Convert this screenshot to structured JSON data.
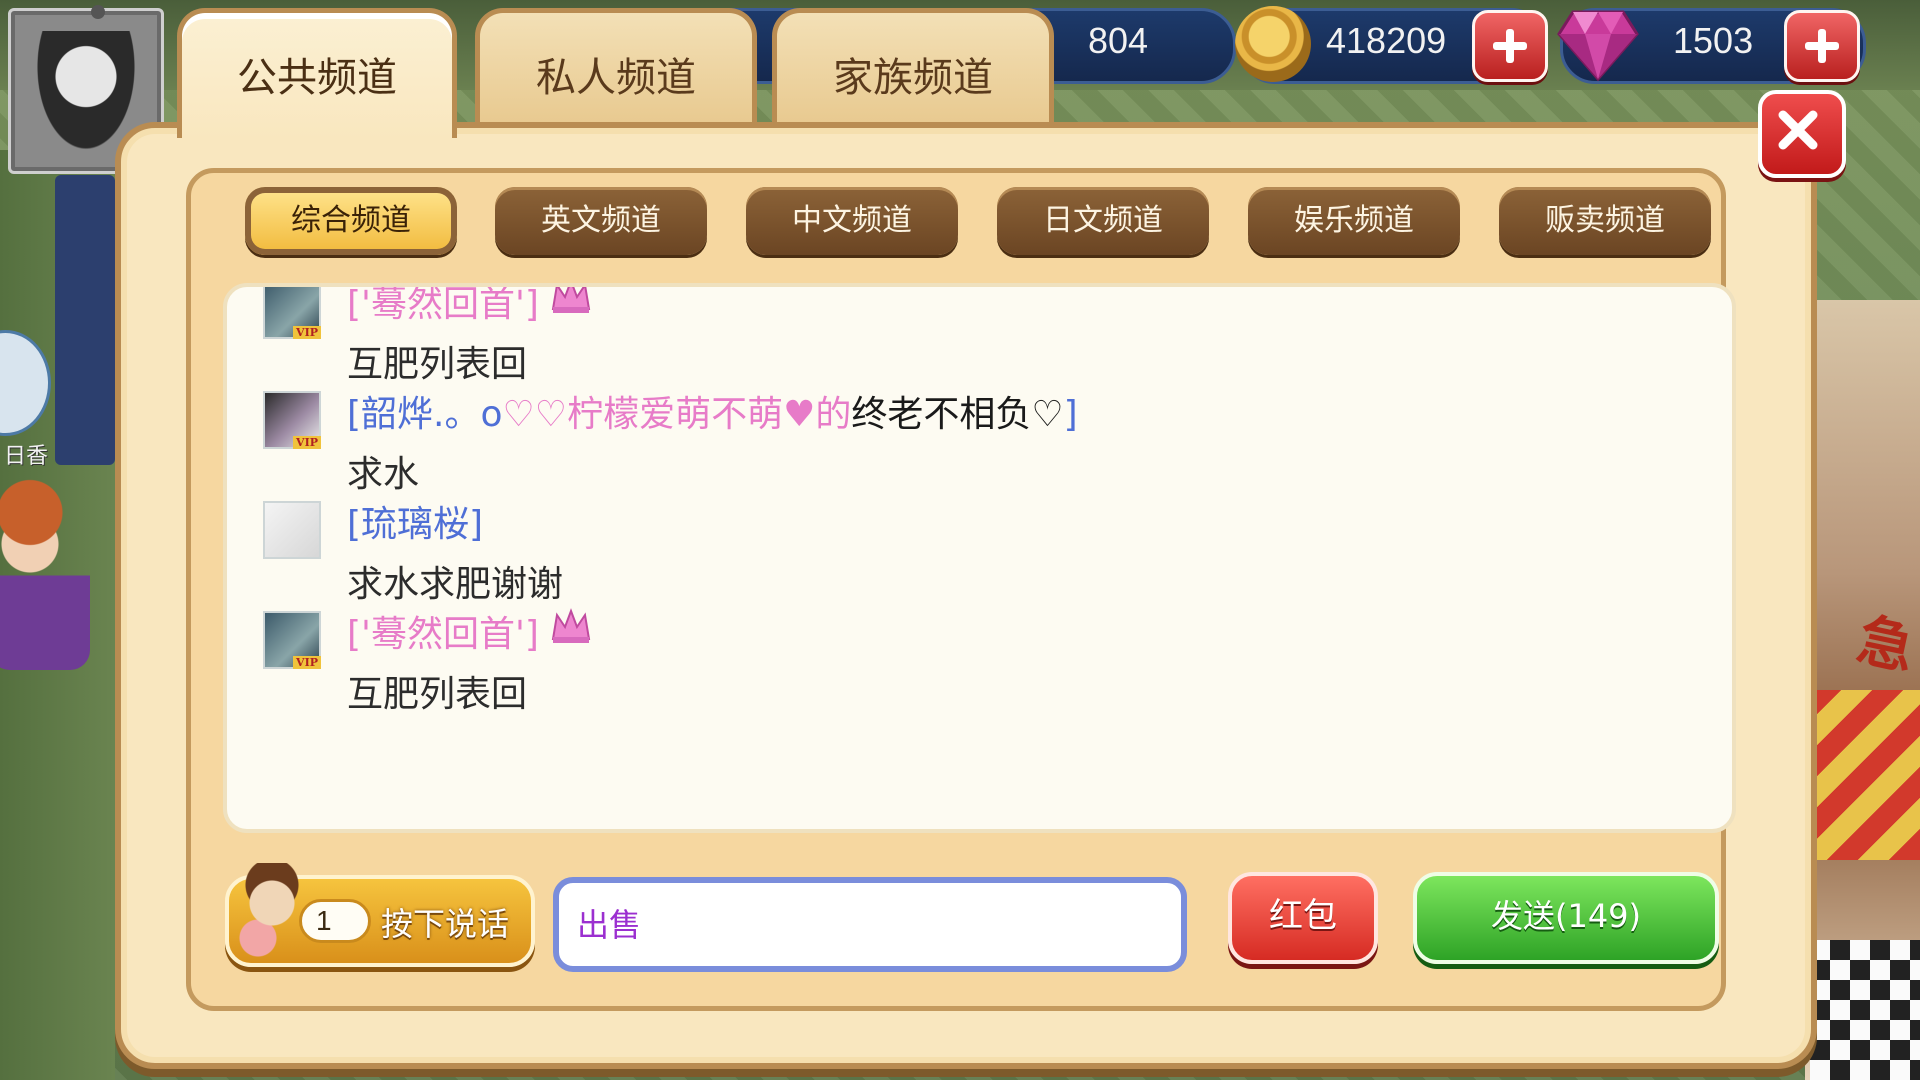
{
  "hud": {
    "stat_value": "804",
    "coins": "418209",
    "gems": "1503"
  },
  "tabs": [
    {
      "label": "公共频道",
      "active": true
    },
    {
      "label": "私人频道",
      "active": false
    },
    {
      "label": "家族频道",
      "active": false
    }
  ],
  "subtabs": [
    {
      "label": "综合频道",
      "active": true
    },
    {
      "label": "英文频道",
      "active": false
    },
    {
      "label": "中文频道",
      "active": false
    },
    {
      "label": "日文频道",
      "active": false
    },
    {
      "label": "娱乐频道",
      "active": false
    },
    {
      "label": "贩卖频道",
      "active": false
    }
  ],
  "messages": [
    {
      "name": "['蓦然回首']",
      "text": "互肥列表回",
      "vip": true,
      "crown": true
    },
    {
      "name_parts": [
        "[韶烨.。o",
        "♡♡柠檬爱萌不萌♥的",
        "终老不相负♡",
        "]"
      ],
      "text": "求水",
      "vip": true,
      "crown": false
    },
    {
      "name": "[琉璃桜]",
      "text": "求水求肥谢谢",
      "vip": false,
      "crown": false
    },
    {
      "name": "['蓦然回首']",
      "text": "互肥列表回",
      "vip": true,
      "crown": true
    }
  ],
  "vip_badge": "VIP",
  "background": {
    "side_label": "日香"
  },
  "bottom": {
    "voice_count": "1",
    "voice_label": "按下说话",
    "input_value": "出售",
    "redpack_label": "红包",
    "send_label": "发送(149)"
  },
  "colors": {
    "panel_bg": "#f9e7bf",
    "panel_border": "#b98c52",
    "name_pink": "#e77bc8",
    "name_blue": "#4f6fd6",
    "send_green": "#2ea326",
    "redpack_red": "#d62b23",
    "input_text": "#9b2fd0"
  }
}
